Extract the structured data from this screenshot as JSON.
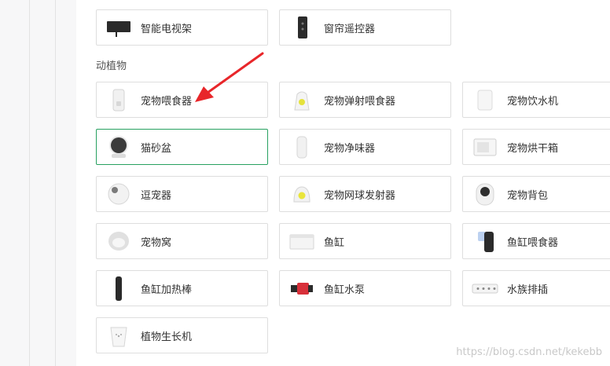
{
  "top_row": [
    {
      "label": "智能电视架",
      "icon": "tv-mount-icon"
    },
    {
      "label": "窗帘遥控器",
      "icon": "curtain-remote-icon"
    }
  ],
  "section": {
    "title": "动植物",
    "items": [
      {
        "label": "宠物喂食器",
        "icon": "pet-feeder-icon"
      },
      {
        "label": "宠物弹射喂食器",
        "icon": "pet-launcher-feeder-icon"
      },
      {
        "label": "宠物饮水机",
        "icon": "pet-water-fountain-icon"
      },
      {
        "label": "猫砂盆",
        "icon": "litter-box-icon"
      },
      {
        "label": "宠物净味器",
        "icon": "pet-deodorizer-icon"
      },
      {
        "label": "宠物烘干箱",
        "icon": "pet-dryer-icon"
      },
      {
        "label": "逗宠器",
        "icon": "pet-teaser-icon"
      },
      {
        "label": "宠物网球发射器",
        "icon": "tennis-launcher-icon"
      },
      {
        "label": "宠物背包",
        "icon": "pet-backpack-icon"
      },
      {
        "label": "宠物窝",
        "icon": "pet-bed-icon"
      },
      {
        "label": "鱼缸",
        "icon": "aquarium-icon"
      },
      {
        "label": "鱼缸喂食器",
        "icon": "aquarium-feeder-icon"
      },
      {
        "label": "鱼缸加热棒",
        "icon": "aquarium-heater-icon"
      },
      {
        "label": "鱼缸水泵",
        "icon": "aquarium-pump-icon"
      },
      {
        "label": "水族排插",
        "icon": "aquarium-power-strip-icon"
      },
      {
        "label": "植物生长机",
        "icon": "plant-grower-icon"
      }
    ]
  },
  "watermark": "https://blog.csdn.net/kekebb"
}
